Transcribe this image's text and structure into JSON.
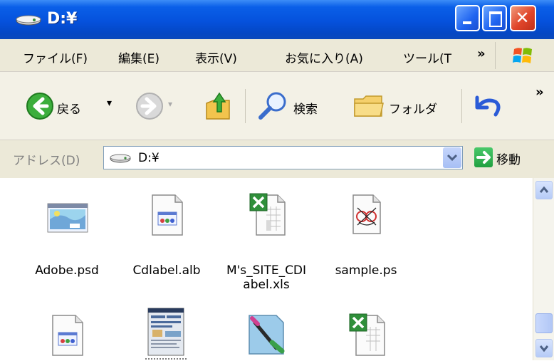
{
  "window": {
    "title": "D:¥",
    "buttons": [
      "minimize-button",
      "maximize-button",
      "close-button"
    ]
  },
  "menu": {
    "items": [
      "ファイル(F)",
      "編集(E)",
      "表示(V)",
      "お気に入り(A)",
      "ツール(T"
    ],
    "chevron": "»"
  },
  "toolbar": {
    "back_label": "戻る",
    "search_label": "検索",
    "folders_label": "フォルダ",
    "chevron": "»"
  },
  "address": {
    "label": "アドレス(D)",
    "value": "D:¥",
    "go_label": "移動"
  },
  "files": [
    {
      "name": "Adobe.psd",
      "icon": "psd-image-icon"
    },
    {
      "name": "Cdlabel.alb",
      "icon": "alb-document-icon"
    },
    {
      "name": "M's_SITE_CDI abel.xls",
      "icon": "excel-file-icon"
    },
    {
      "name": "sample.ps",
      "icon": "ps-file-icon"
    },
    {
      "name": "",
      "icon": "alb-document-icon"
    },
    {
      "name": "",
      "icon": "thumbnail-image-icon"
    },
    {
      "name": "",
      "icon": "paint-image-icon"
    },
    {
      "name": "",
      "icon": "excel-file-icon"
    }
  ],
  "colors": {
    "titlebar": "#0551dc",
    "menubar": "#ece9d8",
    "close_red": "#e0452a"
  }
}
